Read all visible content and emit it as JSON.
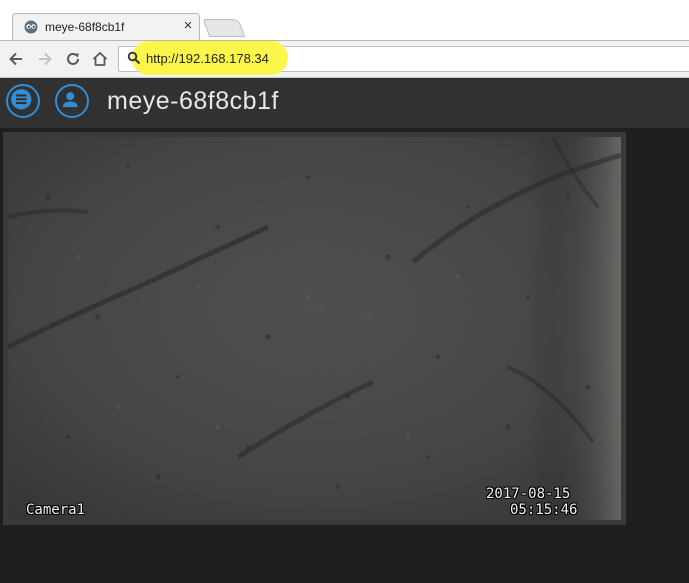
{
  "browser": {
    "tab_title": "meye-68f8cb1f",
    "tab_close": "×",
    "url": "http://192.168.178.34",
    "favicon_icon": "motioneye-favicon-icon",
    "nav_icons": [
      "back-arrow-icon",
      "forward-arrow-icon",
      "reload-icon",
      "home-icon"
    ],
    "url_icon": "search-icon",
    "highlight_color": "#fbf74a"
  },
  "app": {
    "title": "meye-68f8cb1f",
    "menu_icon": "hamburger-menu-icon",
    "user_icon": "user-icon",
    "accent_color": "#2f8ed7",
    "header_bg": "#313131",
    "content_bg": "#1f1f1f"
  },
  "camera": {
    "name_overlay": "Camera1",
    "date_overlay": "2017-08-15",
    "time_overlay": "05:15:46"
  }
}
